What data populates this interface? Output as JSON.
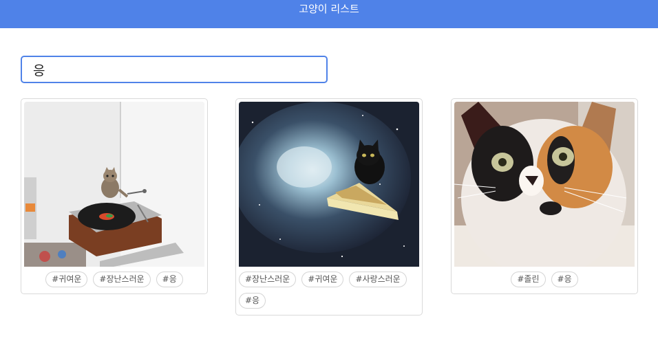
{
  "header": {
    "title": "고양이 리스트"
  },
  "search": {
    "value": "응"
  },
  "cards": [
    {
      "image_name": "cat-on-record-player-photo",
      "tags": [
        "#귀여운",
        "#장난스러운",
        "#응"
      ]
    },
    {
      "image_name": "cat-in-space-taco-photo",
      "tags": [
        "#장난스러운",
        "#귀여운",
        "#사랑스러운",
        "#응"
      ]
    },
    {
      "image_name": "calico-cat-face-photo",
      "tags": [
        "#졸린",
        "#응"
      ]
    }
  ],
  "colors": {
    "header_bg": "#4f82e8",
    "search_border": "#4f82e8",
    "tag_border": "#d4d4d4"
  }
}
